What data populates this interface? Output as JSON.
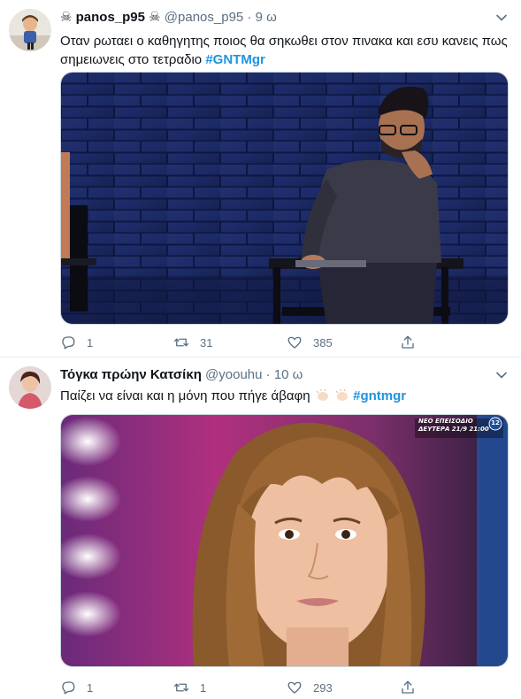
{
  "tweets": [
    {
      "display_name": "panos_p95",
      "name_prefix_icon": "skull-crossbones",
      "name_suffix_icon": "skull-crossbones",
      "handle": "@panos_p95",
      "separator": "·",
      "time": "9 ω",
      "text": "Οταν ρωταει ο καθηγητης ποιος θα σηκωθει στον πινακα και εσυ κανεις πως σημειωνεις στο τετραδιο",
      "hashtag": "#GNTMgr",
      "counts": {
        "replies": "1",
        "retweets": "31",
        "likes": "385"
      }
    },
    {
      "display_name": "Τόγκα πρώην Κατσίκη",
      "handle": "@yoouhu",
      "separator": "·",
      "time": "10 ω",
      "text": "Παίζει να είναι και η μόνη που πήγε άβαφη",
      "emoji": [
        "clapping-hands",
        "clapping-hands"
      ],
      "hashtag": "#gntmgr",
      "overlay": {
        "line1": "ΝΕΟ ΕΠΕΙΣΟΔΙΟ",
        "line2": "ΔΕΥΤΕΡΑ 21/9 21:00",
        "badge": "12"
      },
      "counts": {
        "replies": "1",
        "retweets": "1",
        "likes": "293"
      }
    }
  ],
  "colors": {
    "accent": "#1b95e0",
    "secondary_text": "#5b7083",
    "divider": "#e6ecf0"
  }
}
